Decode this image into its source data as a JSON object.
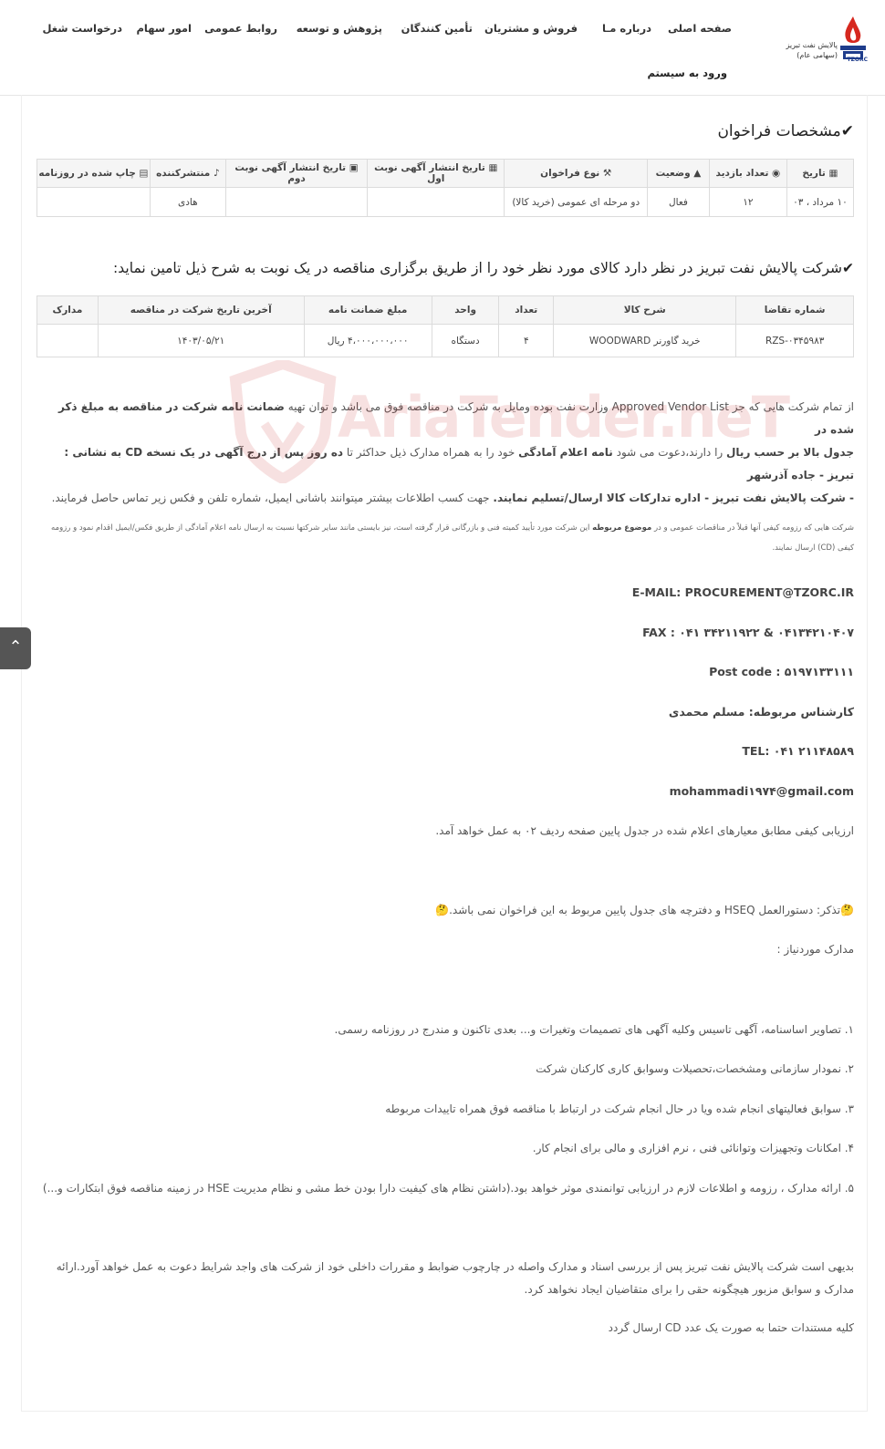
{
  "header": {
    "logo_text": [
      "پالایش نفت تبریز",
      "(سهامی عام)"
    ],
    "logo_badge": "TZORC",
    "nav": [
      "صفحه اصلی",
      "درباره مـا",
      "فروش و مشتریان",
      "تأمین کنندگان",
      "پژوهش و توسعه",
      "روابط عمومی",
      "امور سهام",
      "درخواست شغل"
    ],
    "login": "ورود به سیستم"
  },
  "section1": {
    "title": "مشخصات فراخوان",
    "headers": [
      "تاریخ",
      "تعداد بازدید",
      "وضعیت",
      "نوع فراخوان",
      "تاریخ انتشار آگهی نوبت اول",
      "تاریخ انتشار آگهی نوبت دوم",
      "منتشرکننده",
      "چاپ شده در روزنامه"
    ],
    "row": [
      "۱۰ مرداد ، ۰۳",
      "۱۲",
      "فعال",
      "دو مرحله ای عمومی (خرید کالا)",
      "",
      "",
      "هادی",
      ""
    ]
  },
  "section2": {
    "title": "شرکت پالایش نفت تبریز در نظر دارد کالای مورد نظر خود را از طریق برگزاری مناقصه در یک نوبت به شرح ذیل تامین نماید:",
    "headers": [
      "شماره تقاضا",
      "شرح کالا",
      "تعداد",
      "واحد",
      "مبلغ ضمانت نامه",
      "آخرین تاریخ شرکت در مناقصه",
      "مدارک"
    ],
    "row": [
      "RZS-۰۳۴۵۹۸۳",
      "خرید گاورنر WOODWARD",
      "۴",
      "دستگاه",
      "۴،۰۰۰،۰۰۰،۰۰۰ ریال",
      "۱۴۰۳/۰۵/۲۱",
      ""
    ]
  },
  "watermark": "AriaTender.neT",
  "para1": {
    "l1a": "از تمام شرکت هایی که جز Approved Vendor List وزارت نفت بوده ومایل به شرکت در مناقصه فوق می باشد و توان تهیه ",
    "l1b": "ضمانت نامه شرکت در مناقصه به مبلغ ذکر شده در",
    "l2a": "جدول بالا بر حسب ریال",
    "l2b": " را دارند،دعوت می شود ",
    "l2c": "نامه اعلام آمادگی",
    "l2d": " خود را به همراه مدارک ذیل حداکثر تا ",
    "l2e": "ده روز پس از درج آگهی در یک نسخه CD به نشانی : تبریز - جاده آذرشهر",
    "l3a": "- شرکت پالایش نفت تبریز - اداره تدارکات کالا ارسال/تسلیم نمایند.",
    "l3b": " جهت کسب اطلاعات بیشتر میتوانند باشانی ایمیل، شماره تلفن و فکس زیر تماس حاصل فرمایند."
  },
  "para2": {
    "l1a": "شرکت هایی که رزومه کیفی آنها قبلاً در مناقصات عمومی و در ",
    "l1b": "موضوع مربوطه",
    "l1c": " این شرکت مورد تأیید کمیته فنی و بازرگانی قرار گرفته است، نیز بایستی مانند سایر شرکتها نسبت به ارسال نامه اعلام آمادگی از طریق فکس/ایمیل اقدام نمود و رزومه",
    "l2": "کیفی  (CD)  ارسال نمایند."
  },
  "contacts": {
    "email": "E-MAIL: PROCUREMENT@TZORC.IR",
    "fax": "FAX : ۰۴۱ ۳۴۲۱۱۹۲۲ & ۰۴۱۳۴۲۱۰۴۰۷",
    "postcode": "Post code : ۵۱۹۷۱۳۳۱۱۱",
    "expert": "کارشناس مربوطه: مسلم محمدی",
    "tel": "TEL: ۰۴۱ ۲۱۱۴۸۵۸۹",
    "gmail": "mohammadi۱۹۷۴@gmail.com"
  },
  "evaluation": "ارزیابی کیفی مطابق معیارهای اعلام شده در جدول پایین صفحه ردیف ۰۲ به عمل خواهد آمد.",
  "note": "تذکر: دستورالعمل HSEQ و دفترچه های جدول پایین مربوط به این فراخوان نمی باشد.",
  "docs_title": "مدارک موردنیاز :",
  "docs": [
    "۱. تصاویر اساسنامه، آگهی تاسیس وکلیه آگهی های تصمیمات وتغیرات و... بعدی تاکنون و مندرج در روزنامه رسمی.",
    "۲. نمودار سازمانی ومشخصات،تحصیلات وسوابق کاری کارکنان شرکت",
    "۳. سوابق فعالیتهای انجام شده ویا در حال انجام شرکت در ارتباط با مناقصه فوق همراه تاییدات مربوطه",
    "۴. امکانات وتجهیزات وتوانائی فنی ، نرم افزاری و مالی برای انجام کار.",
    "۵. ارائه مدارک ، رزومه و اطلاعات لازم در ارزیابی توانمندی موثر خواهد بود.(داشتن نظام های کیفیت دارا بودن خط مشی و نظام  مدیریت HSE در زمینه مناقصه فوق ابتکارات و...)"
  ],
  "closing": [
    "بدیهی است شرکت پالایش نفت تبریز پس از بررسی اسناد و مدارک واصله در چارچوب ضوابط و مقررات داخلی خود از شرکت های واجد شرایط دعوت به عمل خواهد آورد.ارائه",
    "مدارک و سوابق مزبور هیچگونه حقی را برای متقاضیان ایجاد نخواهد کرد."
  ],
  "cd_note": "کلیه مستندات حتما  به صورت یک عدد CD ارسال گردد",
  "icons": {
    "check": "✔",
    "scroll_up": "⌃"
  },
  "colors": {
    "logo_red": "#d6281f",
    "logo_blue": "#1f3d8c",
    "watermark": "#c61f1f"
  }
}
